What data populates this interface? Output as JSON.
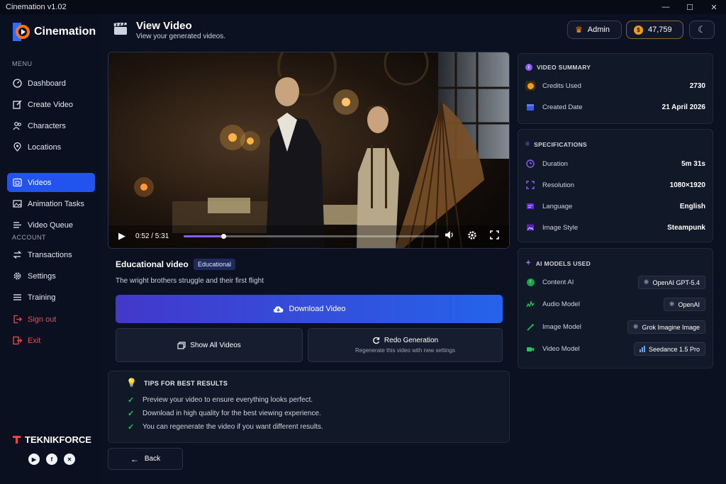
{
  "window": {
    "title": "Cinemation v1.02"
  },
  "brand": {
    "name": "Cinemation"
  },
  "sidebar": {
    "menu_label": "MENU",
    "account_label": "ACCOUNT",
    "menu_items": [
      {
        "label": "Dashboard",
        "icon": "dashboard-icon"
      },
      {
        "label": "Create Video",
        "icon": "edit-icon"
      },
      {
        "label": "Characters",
        "icon": "users-icon"
      },
      {
        "label": "Locations",
        "icon": "pin-icon"
      },
      {
        "label": "Videos",
        "icon": "video-icon",
        "active": true
      },
      {
        "label": "Animation Tasks",
        "icon": "image-icon"
      },
      {
        "label": "Video Queue",
        "icon": "queue-icon"
      }
    ],
    "account_items": [
      {
        "label": "Transactions",
        "icon": "transactions-icon"
      },
      {
        "label": "Settings",
        "icon": "gear-icon"
      },
      {
        "label": "Training",
        "icon": "list-icon"
      },
      {
        "label": "Sign out",
        "icon": "signout-icon"
      },
      {
        "label": "Exit",
        "icon": "exit-icon"
      }
    ],
    "footer_brand": "TEKNIKFORCE",
    "social": [
      "youtube-icon",
      "facebook-icon",
      "x-icon"
    ]
  },
  "header": {
    "title": "View Video",
    "subtitle": "View your generated videos.",
    "user": "Admin",
    "credits": "47,759"
  },
  "player": {
    "time": "0:52 / 5:31",
    "progress": 0.157
  },
  "video": {
    "title": "Educational video",
    "badge": "Educational",
    "description": "The wright brothers struggle and their first flight"
  },
  "actions": {
    "download": "Download Video",
    "show_all": "Show All Videos",
    "redo": "Redo Generation",
    "redo_sub": "Regenerate this video with new settings",
    "back": "Back"
  },
  "tips": {
    "title": "TIPS FOR BEST RESULTS",
    "items": [
      "Preview your video to ensure everything looks perfect.",
      "Download in high quality for the best viewing experience.",
      "You can regenerate the video if you want different results."
    ]
  },
  "summary": {
    "title": "VIDEO SUMMARY",
    "credits_label": "Credits Used",
    "credits_value": "2730",
    "created_label": "Created Date",
    "created_value": "21 April 2026"
  },
  "specs": {
    "title": "SPECIFICATIONS",
    "rows": [
      {
        "label": "Duration",
        "value": "5m 31s"
      },
      {
        "label": "Resolution",
        "value": "1080×1920"
      },
      {
        "label": "Language",
        "value": "English"
      },
      {
        "label": "Image Style",
        "value": "Steampunk"
      }
    ]
  },
  "models": {
    "title": "AI MODELS USED",
    "rows": [
      {
        "label": "Content AI",
        "value": "OpenAI GPT-5.4"
      },
      {
        "label": "Audio Model",
        "value": "OpenAI"
      },
      {
        "label": "Image Model",
        "value": "Grok Imagine Image"
      },
      {
        "label": "Video Model",
        "value": "Seedance 1.5 Pro"
      }
    ]
  },
  "colors": {
    "accent": "#2353ef",
    "danger": "#f04a4a",
    "success": "#22c55e",
    "gold": "#f59e0b"
  }
}
